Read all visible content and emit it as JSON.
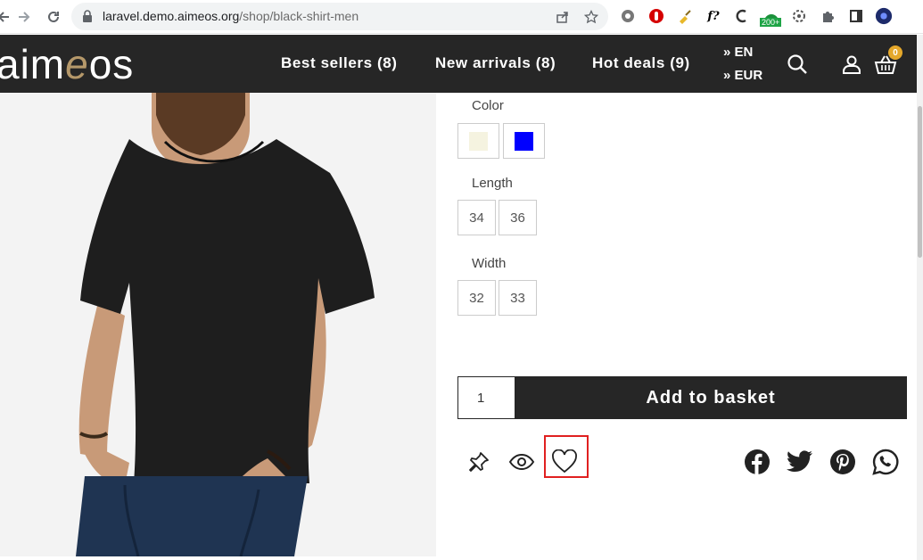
{
  "browser": {
    "url_domain": "laravel.demo.aimeos.org",
    "url_path": "/shop/black-shirt-men",
    "extension_badge": "200+"
  },
  "header": {
    "logo_pre": "aim",
    "logo_e": "e",
    "logo_post": "os",
    "menu": [
      "Best sellers (8)",
      "New arrivals (8)",
      "Hot deals (9)"
    ],
    "language": "» EN",
    "currency": "» EUR",
    "basket_count": "0"
  },
  "product": {
    "color_label": "Color",
    "colors": [
      "#f5f3e0",
      "#0000ff"
    ],
    "length_label": "Length",
    "lengths": [
      "34",
      "36"
    ],
    "width_label": "Width",
    "widths": [
      "32",
      "33"
    ],
    "quantity": "1",
    "add_button": "Add to basket"
  },
  "colors": {
    "header_bg": "#262626",
    "accent": "#b5986a",
    "badge": "#e5a82b",
    "highlight": "#e02020"
  }
}
